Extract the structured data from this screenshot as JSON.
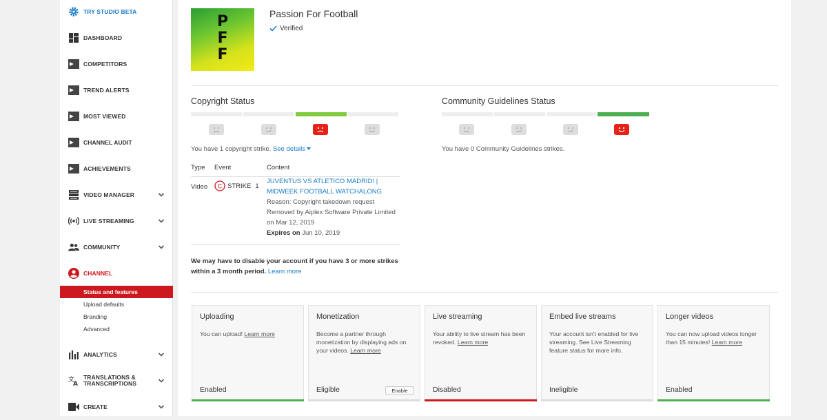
{
  "sidebar": {
    "items": [
      {
        "label": "TRY STUDIO BETA",
        "icon": "gear-icon"
      },
      {
        "label": "DASHBOARD",
        "icon": "dashboard-icon"
      },
      {
        "label": "COMPETITORS",
        "icon": "vidiq-icon"
      },
      {
        "label": "TREND ALERTS",
        "icon": "vidiq-icon"
      },
      {
        "label": "MOST VIEWED",
        "icon": "vidiq-icon"
      },
      {
        "label": "CHANNEL AUDIT",
        "icon": "vidiq-icon"
      },
      {
        "label": "ACHIEVEMENTS",
        "icon": "vidiq-icon"
      },
      {
        "label": "VIDEO MANAGER",
        "icon": "video-manager-icon"
      },
      {
        "label": "LIVE STREAMING",
        "icon": "live-streaming-icon"
      },
      {
        "label": "COMMUNITY",
        "icon": "community-icon"
      },
      {
        "label": "CHANNEL",
        "icon": "channel-icon"
      },
      {
        "label": "ANALYTICS",
        "icon": "analytics-icon"
      },
      {
        "label": "TRANSLATIONS & TRANSCRIPTIONS",
        "icon": "translate-icon"
      },
      {
        "label": "CREATE",
        "icon": "create-icon"
      }
    ],
    "channel_subitems": [
      "Status and features",
      "Upload defaults",
      "Branding",
      "Advanced"
    ]
  },
  "channel": {
    "name": "Passion For Football",
    "verified_label": "Verified",
    "avatar_letters": "PFF"
  },
  "copyright": {
    "title": "Copyright Status",
    "summary": "You have 1 copyright strike.",
    "see_details": "See details",
    "table_headers": [
      "Type",
      "Event",
      "Content"
    ],
    "row": {
      "type": "Video",
      "event": "STRIKE",
      "event_count": "1",
      "content_title": "JUVENTUS VS ATLETICO MADRID! | MIDWEEK FOOTBALL WATCHALONG",
      "reason": "Reason: Copyright takedown request",
      "removed_by": "Removed by Aiplex Software Private Limited",
      "removed_on": "on Mar 12, 2019",
      "expires_label": "Expires on",
      "expires_date": "Jun 10, 2019"
    },
    "warning": "We may have to disable your account if you have 3 or more strikes within a 3 month period.",
    "warning_link": "Learn more"
  },
  "community": {
    "title": "Community Guidelines Status",
    "summary": "You have 0 Community Guidelines strikes."
  },
  "features": [
    {
      "title": "Uploading",
      "desc": "You can upload!",
      "link": "Learn more",
      "status": "Enabled",
      "bar_color": "#4caf50"
    },
    {
      "title": "Monetization",
      "desc": "Become a partner through monetization by displaying ads on your videos.",
      "link": "Learn more",
      "status": "Eligible",
      "button": "Enable",
      "bar_color": ""
    },
    {
      "title": "Live streaming",
      "desc": "Your ability to live stream has been revoked.",
      "link": "Learn more",
      "status": "Disabled",
      "bar_color": "#cc181e"
    },
    {
      "title": "Embed live streams",
      "desc": "Your account isn't enabled for live streaming. See Live Streaming feature status for more info.",
      "link": "",
      "status": "Ineligible",
      "bar_color": ""
    },
    {
      "title": "Longer videos",
      "desc": "You can now upload videos longer than 15 minutes!",
      "link": "Learn more",
      "status": "Enabled",
      "bar_color": "#4caf50"
    }
  ],
  "colors": {
    "accent_red": "#cc181e",
    "link_blue": "#167ac6",
    "green": "#4caf50"
  }
}
